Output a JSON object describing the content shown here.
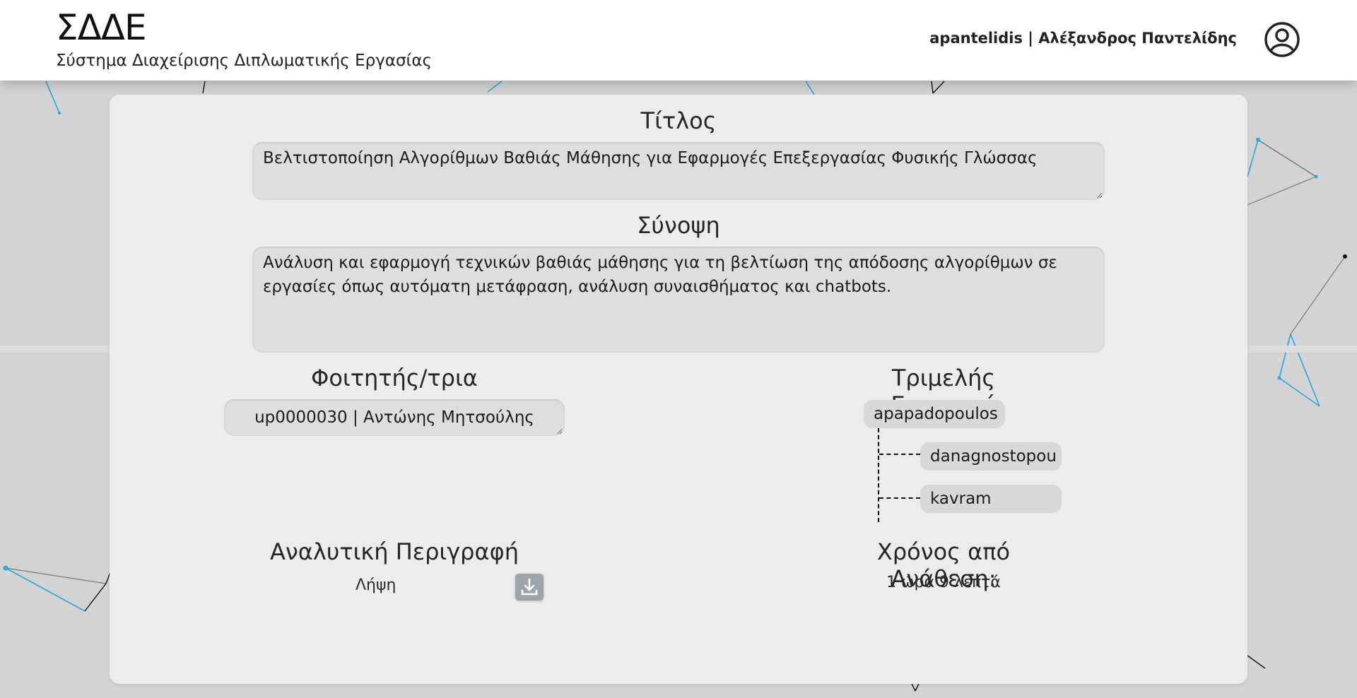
{
  "header": {
    "logo": "ΣΔΔΕ",
    "subtitle": "Σύστημα Διαχείρισης Διπλωματικής Εργασίας",
    "user": "apantelidis | Αλέξανδρος Παντελίδης"
  },
  "thesis": {
    "title_label": "Τίτλος",
    "title_value": "Βελτιστοποίηση Αλγορίθμων Βαθιάς Μάθησης για Εφαρμογές Επεξεργασίας Φυσικής Γλώσσας",
    "summary_label": "Σύνοψη",
    "summary_value": "Ανάλυση και εφαρμογή τεχνικών βαθιάς μάθησης για τη βελτίωση της απόδοσης αλγορίθμων σε εργασίες όπως αυτόματη μετάφραση, ανάλυση συναισθήματος και chatbots.",
    "student_label": "Φοιτητής/τρια",
    "student_value": "up0000030 | Αντώνης Μητσούλης",
    "committee_label": "Τριμελής Επιτροπή",
    "committee": {
      "supervisor": "apapadopoulos",
      "members": [
        "danagnostopou",
        "kavram"
      ]
    },
    "description_label": "Αναλυτική Περιγραφή",
    "download_label": "Λήψη",
    "elapsed_label": "Χρόνος από Ανάθεση:",
    "elapsed_value": "1 ώρα 9 λεπτά"
  },
  "icons": {
    "avatar": "user-circle-icon",
    "download": "download-icon"
  },
  "colors": {
    "background": "#d3d3d3",
    "card": "#eeeeee",
    "field": "#dedede",
    "download_button": "#9ea4aa",
    "network_accent": "#29a9e0"
  }
}
